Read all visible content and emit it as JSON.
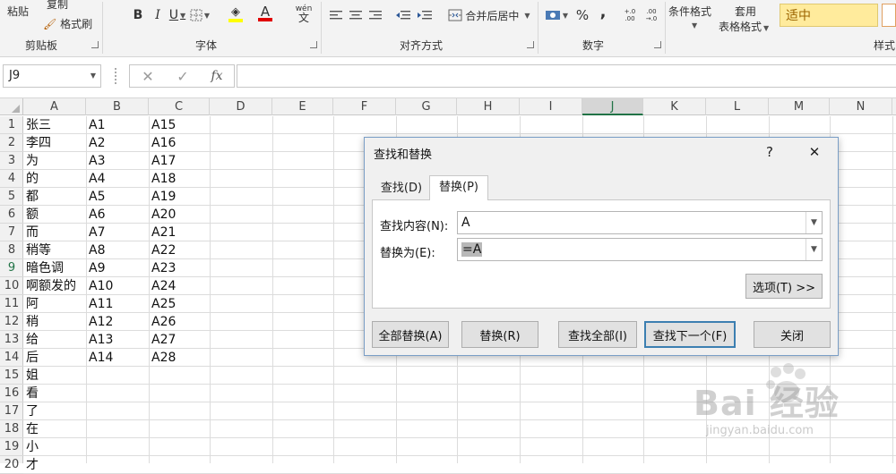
{
  "ribbon": {
    "clipboard": {
      "paste": "粘贴",
      "copy": "复制",
      "format_painter": "格式刷",
      "label": "剪贴板"
    },
    "font": {
      "bold": "B",
      "italic": "I",
      "underline": "U",
      "font_color_glyph": "A",
      "wen": "wén",
      "wen_char": "文",
      "label": "字体"
    },
    "alignment": {
      "merge_center": "合并后居中",
      "label": "对齐方式"
    },
    "number": {
      "percent": "%",
      "comma": ",",
      "inc_decimal": "+.0 .00",
      "dec_decimal": ".00 →.0",
      "label": "数字"
    },
    "styles": {
      "conditional_format": "条件格式",
      "table_format_1": "套用",
      "table_format_2": "表格格式",
      "neutral": "适中",
      "label": "样式"
    },
    "colors": {
      "neutral_bg": "#ffeb9c",
      "neutral_text": "#9c6500",
      "font_red": "#e00000",
      "fill_yellow": "#ffff00"
    }
  },
  "formula_bar": {
    "name_box": "J9",
    "cancel": "✕",
    "enter": "✓",
    "fx": "fx",
    "content": ""
  },
  "grid": {
    "columns": [
      "A",
      "B",
      "C",
      "D",
      "E",
      "F",
      "G",
      "H",
      "I",
      "J",
      "K",
      "L",
      "M",
      "N"
    ],
    "active_column": "J",
    "active_row": "9",
    "rows": [
      {
        "n": "1",
        "a": "张三",
        "b": "A1",
        "c": "A15"
      },
      {
        "n": "2",
        "a": "李四",
        "b": "A2",
        "c": "A16"
      },
      {
        "n": "3",
        "a": "为",
        "b": "A3",
        "c": "A17"
      },
      {
        "n": "4",
        "a": "的",
        "b": "A4",
        "c": "A18"
      },
      {
        "n": "5",
        "a": "都",
        "b": "A5",
        "c": "A19"
      },
      {
        "n": "6",
        "a": "额",
        "b": "A6",
        "c": "A20"
      },
      {
        "n": "7",
        "a": "而",
        "b": "A7",
        "c": "A21"
      },
      {
        "n": "8",
        "a": "稍等",
        "b": "A8",
        "c": "A22"
      },
      {
        "n": "9",
        "a": "暗色调",
        "b": "A9",
        "c": "A23"
      },
      {
        "n": "10",
        "a": "啊额发的",
        "b": "A10",
        "c": "A24"
      },
      {
        "n": "11",
        "a": "阿",
        "b": "A11",
        "c": "A25"
      },
      {
        "n": "12",
        "a": "稍",
        "b": "A12",
        "c": "A26"
      },
      {
        "n": "13",
        "a": "给",
        "b": "A13",
        "c": "A27"
      },
      {
        "n": "14",
        "a": "后",
        "b": "A14",
        "c": "A28"
      },
      {
        "n": "15",
        "a": "姐",
        "b": "",
        "c": ""
      },
      {
        "n": "16",
        "a": "看",
        "b": "",
        "c": ""
      },
      {
        "n": "17",
        "a": "了",
        "b": "",
        "c": ""
      },
      {
        "n": "18",
        "a": "在",
        "b": "",
        "c": ""
      },
      {
        "n": "19",
        "a": "小",
        "b": "",
        "c": ""
      },
      {
        "n": "20",
        "a": "才",
        "b": "",
        "c": ""
      }
    ]
  },
  "dialog": {
    "title": "查找和替换",
    "help": "?",
    "close": "✕",
    "tabs": {
      "find": "查找(D)",
      "replace": "替换(P)"
    },
    "find_label": "查找内容(N):",
    "find_value": "A",
    "replace_label": "替换为(E):",
    "replace_value": "=A",
    "options_button": "选项(T) >>",
    "buttons": {
      "replace_all": "全部替换(A)",
      "replace": "替换(R)",
      "find_all": "查找全部(I)",
      "find_next": "查找下一个(F)",
      "close": "关闭"
    }
  },
  "watermark": {
    "brand": "Bai 经验",
    "url": "jingyan.baidu.com"
  }
}
